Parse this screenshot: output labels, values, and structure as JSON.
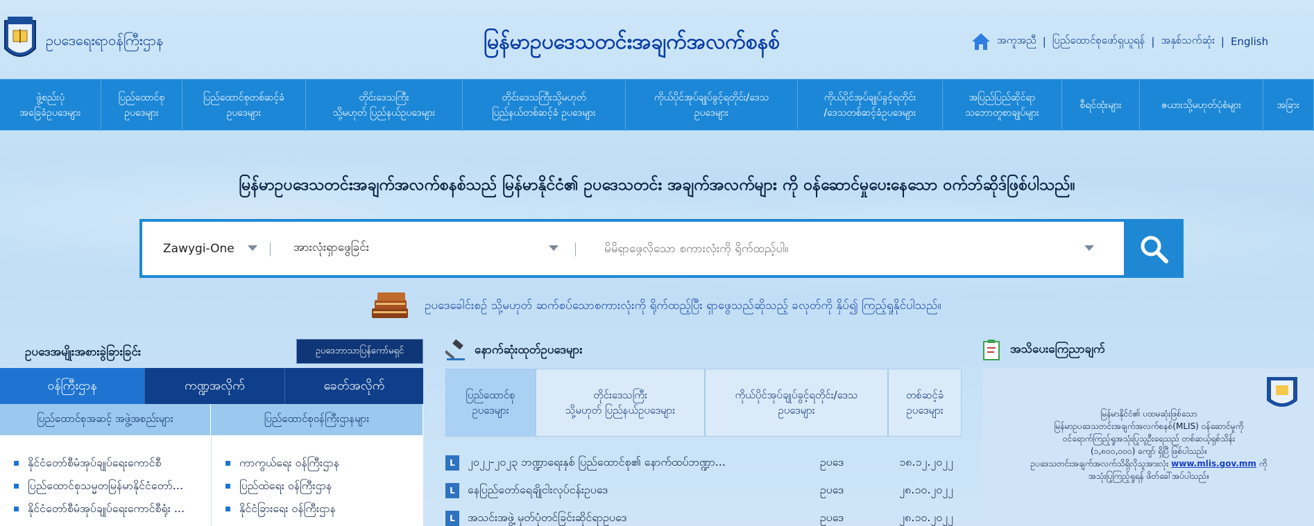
{
  "header": {
    "site_name": "ဥပဒေရေးရာဝန်ကြီးဌာန",
    "main_title": "မြန်မာဥပဒေသတင်းအချက်အလက်စနစ်",
    "links": [
      "အကူအညီ",
      "ပြည်ထောင်စုဖော်ရှယူရန်",
      "အနှစ်သက်ဆုံး",
      "English"
    ]
  },
  "nav": {
    "items": [
      "ဖွဲ့စည်းပုံ\nအခြေခံဥပဒေများ",
      "ပြည်ထောင်စု\nဥပဒေများ",
      "ပြည်ထောင်စုတစ်ဆင့်ခံ\nဥပဒေများ",
      "တိုင်းဒေသကြီး\nသို့မဟုတ် ပြည်နယ်ဥပဒေများ",
      "တိုင်းဒေသကြီးသို့မဟုတ်\nပြည်နယ်တစ်ဆင့်ခံ ဥပဒေများ",
      "ကိုယ်ပိုင်အုပ်ချုပ်ခွင့်ရတိုင်း/ဒေသ\nဥပဒေများ",
      "ကိုယ်ပိုင်အုပ်ချုပ်ခွင့်ရတိုင်း\n/ဒေသတစ်ဆင့်ခံဥပဒေများ",
      "အပြည်ပြည်ဆိုင်ရာ\nသဘောတူစာချုပ်များ",
      "စီရင်ထုံးများ",
      "ဇယားသို့မဟုတ်ပုံစံများ",
      "အခြား"
    ]
  },
  "tagline": "မြန်မာဥပဒေသတင်းအချက်အလက်စနစ်သည် မြန်မာနိုင်ငံ၏ ဥပဒေသတင်း အချက်အလက်များ ကို ဝန်ဆောင်မှုပေးနေသော ဝက်ဘ်ဆိုဒ်ဖြစ်ပါသည်။",
  "search": {
    "font_select": "Zawygi-One",
    "scope_select": "အားလုံးရှာဖွေခြင်း",
    "placeholder": "မိမိရှာဖွေလိုသော စကားလုံးကို ရိုက်ထည့်ပါ။",
    "button_icon": "search-icon"
  },
  "hint": "ဥပဒေခေါင်းစဉ် သို့မဟုတ် ဆက်စပ်သောစကားလုံးကို ရိုက်ထည့်ပြီး ရှာဖွေသည်ဆိုသည့် ခလုတ်ကို နှိပ်၍ ကြည့်ရှုနိုင်ပါသည်။",
  "left": {
    "heading": "ဥပဒေအမျိုးအစားခွဲခြားခြင်း",
    "badge": "ဥပဒေဘာသာပြန်ကော်မရှင်",
    "tabs": [
      "ဝန်ကြီးဌာန",
      "ကဏ္ဍအလိုက်",
      "ခေတ်အလိုက်"
    ],
    "subheads": [
      "ပြည်ထောင်စုအဆင့် အဖွဲ့အစည်းများ",
      "ပြည်ထောင်စုဝန်ကြီးဌာနများ"
    ],
    "list1": [
      "နိုင်ငံတော်စီမံအုပ်ချုပ်ရေးကောင်စီ",
      "ပြည်ထောင်စုသမ္မတမြန်မာနိုင်ငံတော်...",
      "နိုင်ငံတော်စီမံအုပ်ချုပ်ရေးကောင်စီရုံး ..."
    ],
    "list2": [
      "ကာကွယ်ရေး ဝန်ကြီးဌာန",
      "ပြည်ထဲရေး ဝန်ကြီးဌာန",
      "နိုင်ငံခြားရေး ဝန်ကြီးဌာန"
    ]
  },
  "middle": {
    "heading": "နောက်ဆုံးထုတ်ဥပဒေများ",
    "tabs": [
      "ပြည်ထောင်စု\nဥပဒေများ",
      "တိုင်းဒေသကြီး\nသို့မဟုတ် ပြည်နယ်ဥပဒေများ",
      "ကိုယ်ပိုင်အုပ်ချုပ်ခွင့်ရတိုင်း/ဒေသ\nဥပဒေများ",
      "တစ်ဆင့်ခံ\nဥပဒေများ"
    ],
    "laws": [
      {
        "title": "၂၀၂၂-၂၀၂၃ ဘဏ္ဍာရေးနှစ် ပြည်ထောင်စု၏ နောက်ထပ်ဘဏ္ဍာ...",
        "type": "ဥပဒေ",
        "date": "၁၈.၁၂.၂၀၂၂"
      },
      {
        "title": "နေပြည်တော်ရေချိုငါးလုပ်ငန်းဥပဒေ",
        "type": "ဥပဒေ",
        "date": "၂၈.၁၀.၂၀၂၂"
      },
      {
        "title": "အသင်းအဖွဲ့ မှတ်ပုံတင်ခြင်းဆိုင်ရာဥပဒေ",
        "type": "ဥပဒေ",
        "date": "၂၈.၁၀.၂၀၂၂"
      }
    ]
  },
  "right": {
    "heading": "အသိပေးကြေညာချက်",
    "notice_lines": [
      "မြန်မာနိုင်ငံ၏ ပထမဆုံးဖြစ်သော",
      "မြန်မာဥပဒေသတင်းအချက်အလက်စနစ်(MLIS) ဝန်ဆောင်မှုကို",
      "ဝင်ရောက်ကြည့်ရှုအသုံးပြုသူဦးရေသည် တစ်ဆယ့်ရှစ်သိန်း",
      "(၁,၈၀၀,၀၀၀) ကျော် ရှိပြီ ဖြစ်ပါသည်။",
      "ဥပဒေသတင်းအချက်အလက်သိရှိလိုသူအားလုံး",
      "အသုံးပြုကြည့်ရှုရန် ဖိတ်ခေါ်အပ်ပါသည်။"
    ],
    "link": "www.mlis.gov.mm",
    "link_suffix": "ကို"
  },
  "colors": {
    "nav_blue": "#1c87d6",
    "dark_navy": "#0f3777",
    "tab_active": "#1e74d0",
    "tab_inactive": "#0f3f8a"
  }
}
